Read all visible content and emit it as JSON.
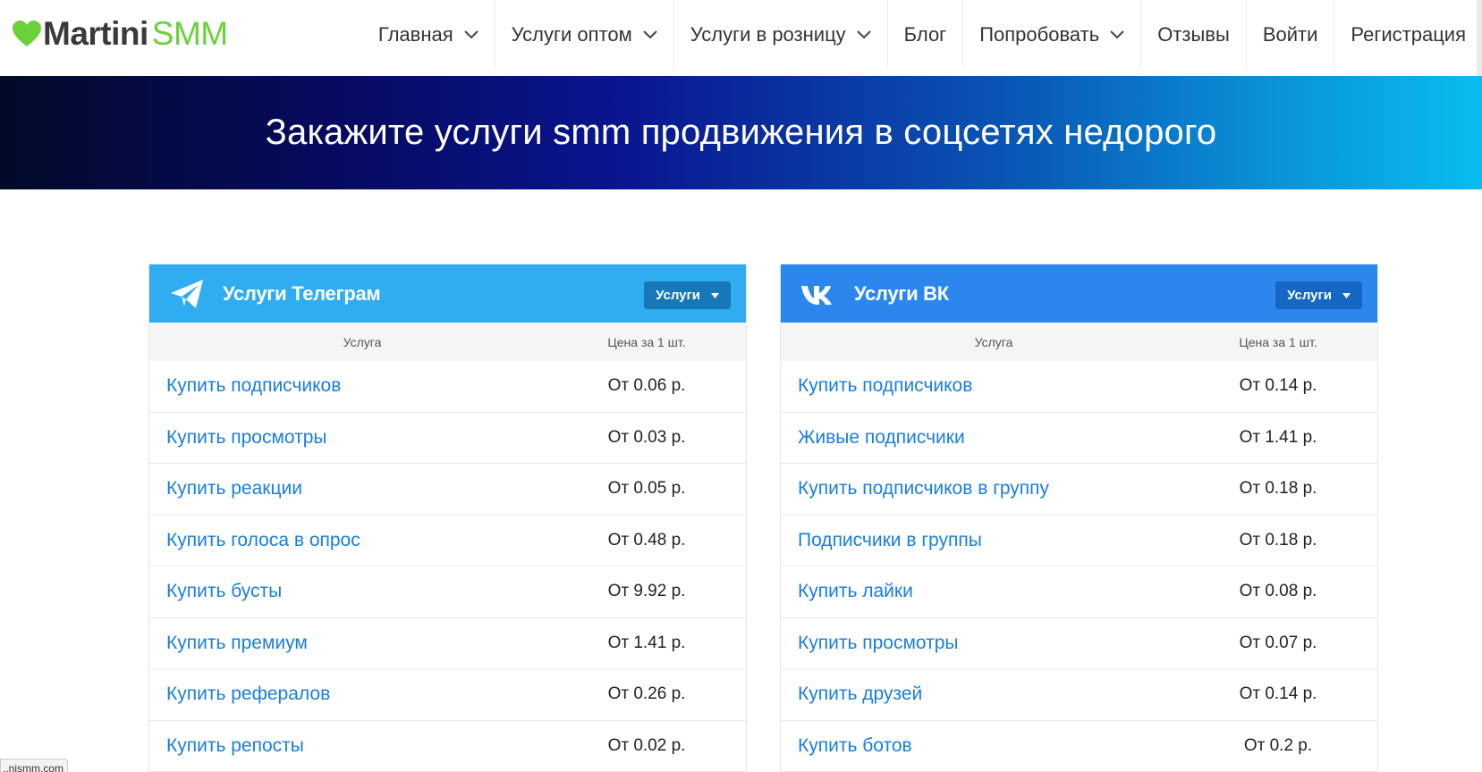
{
  "brand": {
    "part1": "Martini",
    "part2": "SMM",
    "heart_color": "#6ad13a"
  },
  "nav": [
    {
      "label": "Главная",
      "has_dropdown": true
    },
    {
      "label": "Услуги оптом",
      "has_dropdown": true
    },
    {
      "label": "Услуги в розницу",
      "has_dropdown": true
    },
    {
      "label": "Блог",
      "has_dropdown": false
    },
    {
      "label": "Попробовать",
      "has_dropdown": true
    },
    {
      "label": "Отзывы",
      "has_dropdown": false
    },
    {
      "label": "Войти",
      "has_dropdown": false
    },
    {
      "label": "Регистрация",
      "has_dropdown": false
    }
  ],
  "hero": {
    "title": "Закажите услуги smm продвижения в соцсетях недорого"
  },
  "telegram": {
    "title": "Услуги Телеграм",
    "icon": "telegram-plane-icon",
    "dropdown_label": "Услуги",
    "header_color": "#2fadf0",
    "col_service": "Услуга",
    "col_price": "Цена за 1 шт.",
    "rows": [
      {
        "service": "Купить подписчиков",
        "price": "От 0.06 р."
      },
      {
        "service": "Купить просмотры",
        "price": "От 0.03 р."
      },
      {
        "service": "Купить реакции",
        "price": "От 0.05 р."
      },
      {
        "service": "Купить голоса в опрос",
        "price": "От 0.48 р."
      },
      {
        "service": "Купить бусты",
        "price": "От 9.92 р."
      },
      {
        "service": "Купить премиум",
        "price": "От 1.41 р."
      },
      {
        "service": "Купить рефералов",
        "price": "От 0.26 р."
      },
      {
        "service": "Купить репосты",
        "price": "От 0.02 р."
      }
    ]
  },
  "vk": {
    "title": "Услуги ВК",
    "icon": "vk-logo-icon",
    "dropdown_label": "Услуги",
    "header_color": "#2b86ee",
    "col_service": "Услуга",
    "col_price": "Цена за 1 шт.",
    "rows": [
      {
        "service": "Купить подписчиков",
        "price": "От 0.14 р."
      },
      {
        "service": "Живые подписчики",
        "price": "От 1.41 р."
      },
      {
        "service": "Купить подписчиков в группу",
        "price": "От 0.18 р."
      },
      {
        "service": "Подписчики в группы",
        "price": "От 0.18 р."
      },
      {
        "service": "Купить лайки",
        "price": "От 0.08 р."
      },
      {
        "service": "Купить просмотры",
        "price": "От 0.07 р."
      },
      {
        "service": "Купить друзей",
        "price": "От 0.14 р."
      },
      {
        "service": "Купить ботов",
        "price": "От 0.2 р."
      }
    ]
  },
  "status_url": "..nismm.com"
}
